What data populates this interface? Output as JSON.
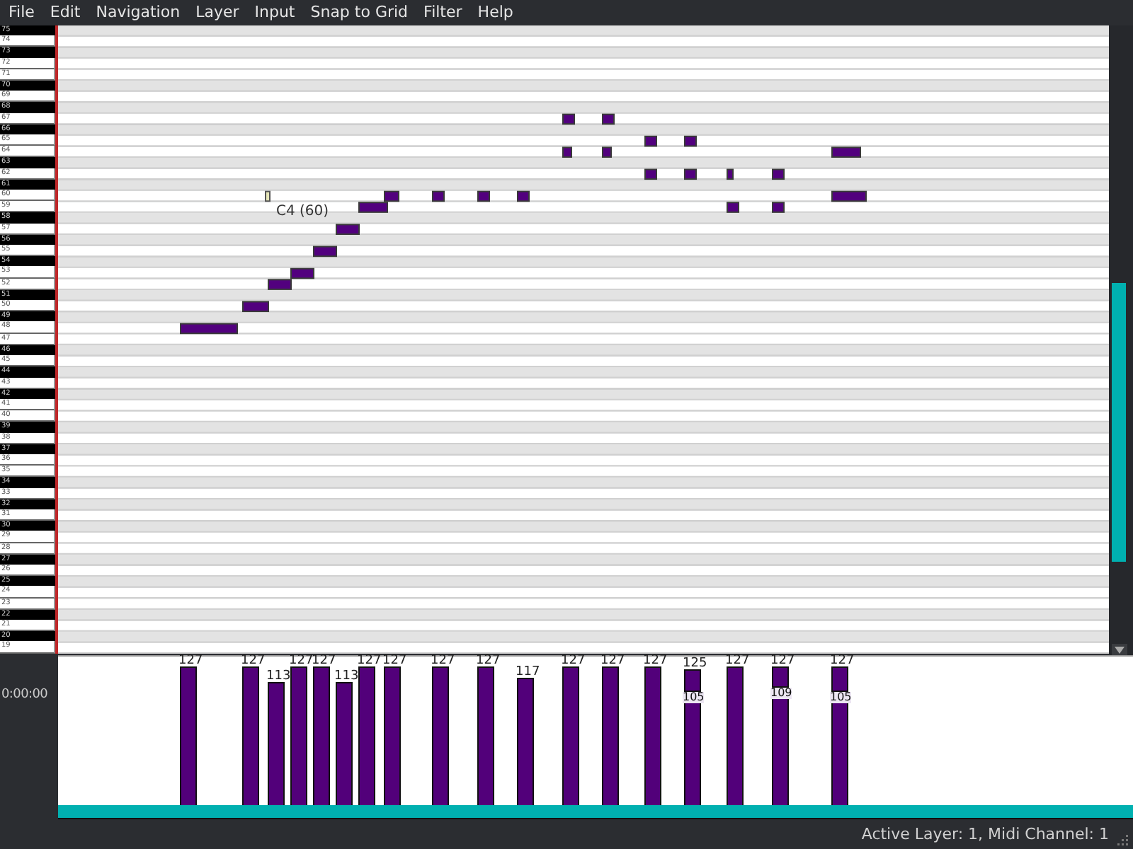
{
  "menu": [
    "File",
    "Edit",
    "Navigation",
    "Layer",
    "Input",
    "Snap to Grid",
    "Filter",
    "Help"
  ],
  "keys": [
    {
      "label": "75",
      "black": true
    },
    {
      "label": "74",
      "black": false
    },
    {
      "label": "73",
      "black": true
    },
    {
      "label": "72",
      "black": false
    },
    {
      "label": "71",
      "black": false
    },
    {
      "label": "70",
      "black": true
    },
    {
      "label": "69",
      "black": false
    },
    {
      "label": "68",
      "black": true
    },
    {
      "label": "67",
      "black": false
    },
    {
      "label": "66",
      "black": true
    },
    {
      "label": "65",
      "black": false
    },
    {
      "label": "64",
      "black": false
    },
    {
      "label": "63",
      "black": true
    },
    {
      "label": "62",
      "black": false
    },
    {
      "label": "61",
      "black": true
    },
    {
      "label": "60",
      "black": false
    },
    {
      "label": "59",
      "black": false
    },
    {
      "label": "58",
      "black": true
    },
    {
      "label": "57",
      "black": false
    },
    {
      "label": "56",
      "black": true
    },
    {
      "label": "55",
      "black": false
    },
    {
      "label": "54",
      "black": true
    },
    {
      "label": "53",
      "black": false
    },
    {
      "label": "52",
      "black": false
    },
    {
      "label": "51",
      "black": true
    },
    {
      "label": "50",
      "black": false
    },
    {
      "label": "49",
      "black": true
    },
    {
      "label": "48",
      "black": false
    },
    {
      "label": "47",
      "black": false
    },
    {
      "label": "46",
      "black": true
    },
    {
      "label": "45",
      "black": false
    },
    {
      "label": "44",
      "black": true
    },
    {
      "label": "43",
      "black": false
    },
    {
      "label": "42",
      "black": true
    },
    {
      "label": "41",
      "black": false
    },
    {
      "label": "40",
      "black": false
    },
    {
      "label": "39",
      "black": true
    },
    {
      "label": "38",
      "black": false
    },
    {
      "label": "37",
      "black": true
    },
    {
      "label": "36",
      "black": false
    },
    {
      "label": "35",
      "black": false
    },
    {
      "label": "34",
      "black": true
    },
    {
      "label": "33",
      "black": false
    },
    {
      "label": "32",
      "black": true
    },
    {
      "label": "31",
      "black": false
    },
    {
      "label": "30",
      "black": true
    },
    {
      "label": "29",
      "black": false
    },
    {
      "label": "28",
      "black": false
    },
    {
      "label": "27",
      "black": true
    },
    {
      "label": "26",
      "black": false
    },
    {
      "label": "25",
      "black": true
    },
    {
      "label": "24",
      "black": false
    },
    {
      "label": "23",
      "black": false
    },
    {
      "label": "22",
      "black": true
    },
    {
      "label": "21",
      "black": false
    },
    {
      "label": "20",
      "black": true
    },
    {
      "label": "19",
      "black": false
    }
  ],
  "cursor_label": "C4 (60)",
  "time": "0:00:00",
  "velocities": [
    {
      "values": [
        "127"
      ]
    },
    {
      "values": [
        "127"
      ]
    },
    {
      "values": [
        "113"
      ]
    },
    {
      "values": [
        "127"
      ]
    },
    {
      "values": [
        "127"
      ]
    },
    {
      "values": [
        "113"
      ]
    },
    {
      "values": [
        "127"
      ]
    },
    {
      "values": [
        "127"
      ]
    },
    {
      "values": [
        "127"
      ]
    },
    {
      "values": [
        "127"
      ]
    },
    {
      "values": [
        "117"
      ]
    },
    {
      "values": [
        "127"
      ]
    },
    {
      "values": [
        "127"
      ]
    },
    {
      "values": [
        "127"
      ]
    },
    {
      "values": [
        "125",
        "105"
      ]
    },
    {
      "values": [
        "127"
      ]
    },
    {
      "values": [
        "127",
        "109"
      ]
    },
    {
      "values": [
        "127",
        "105"
      ]
    }
  ],
  "status_bar": "Active Layer: 1, Midi Channel: 1"
}
